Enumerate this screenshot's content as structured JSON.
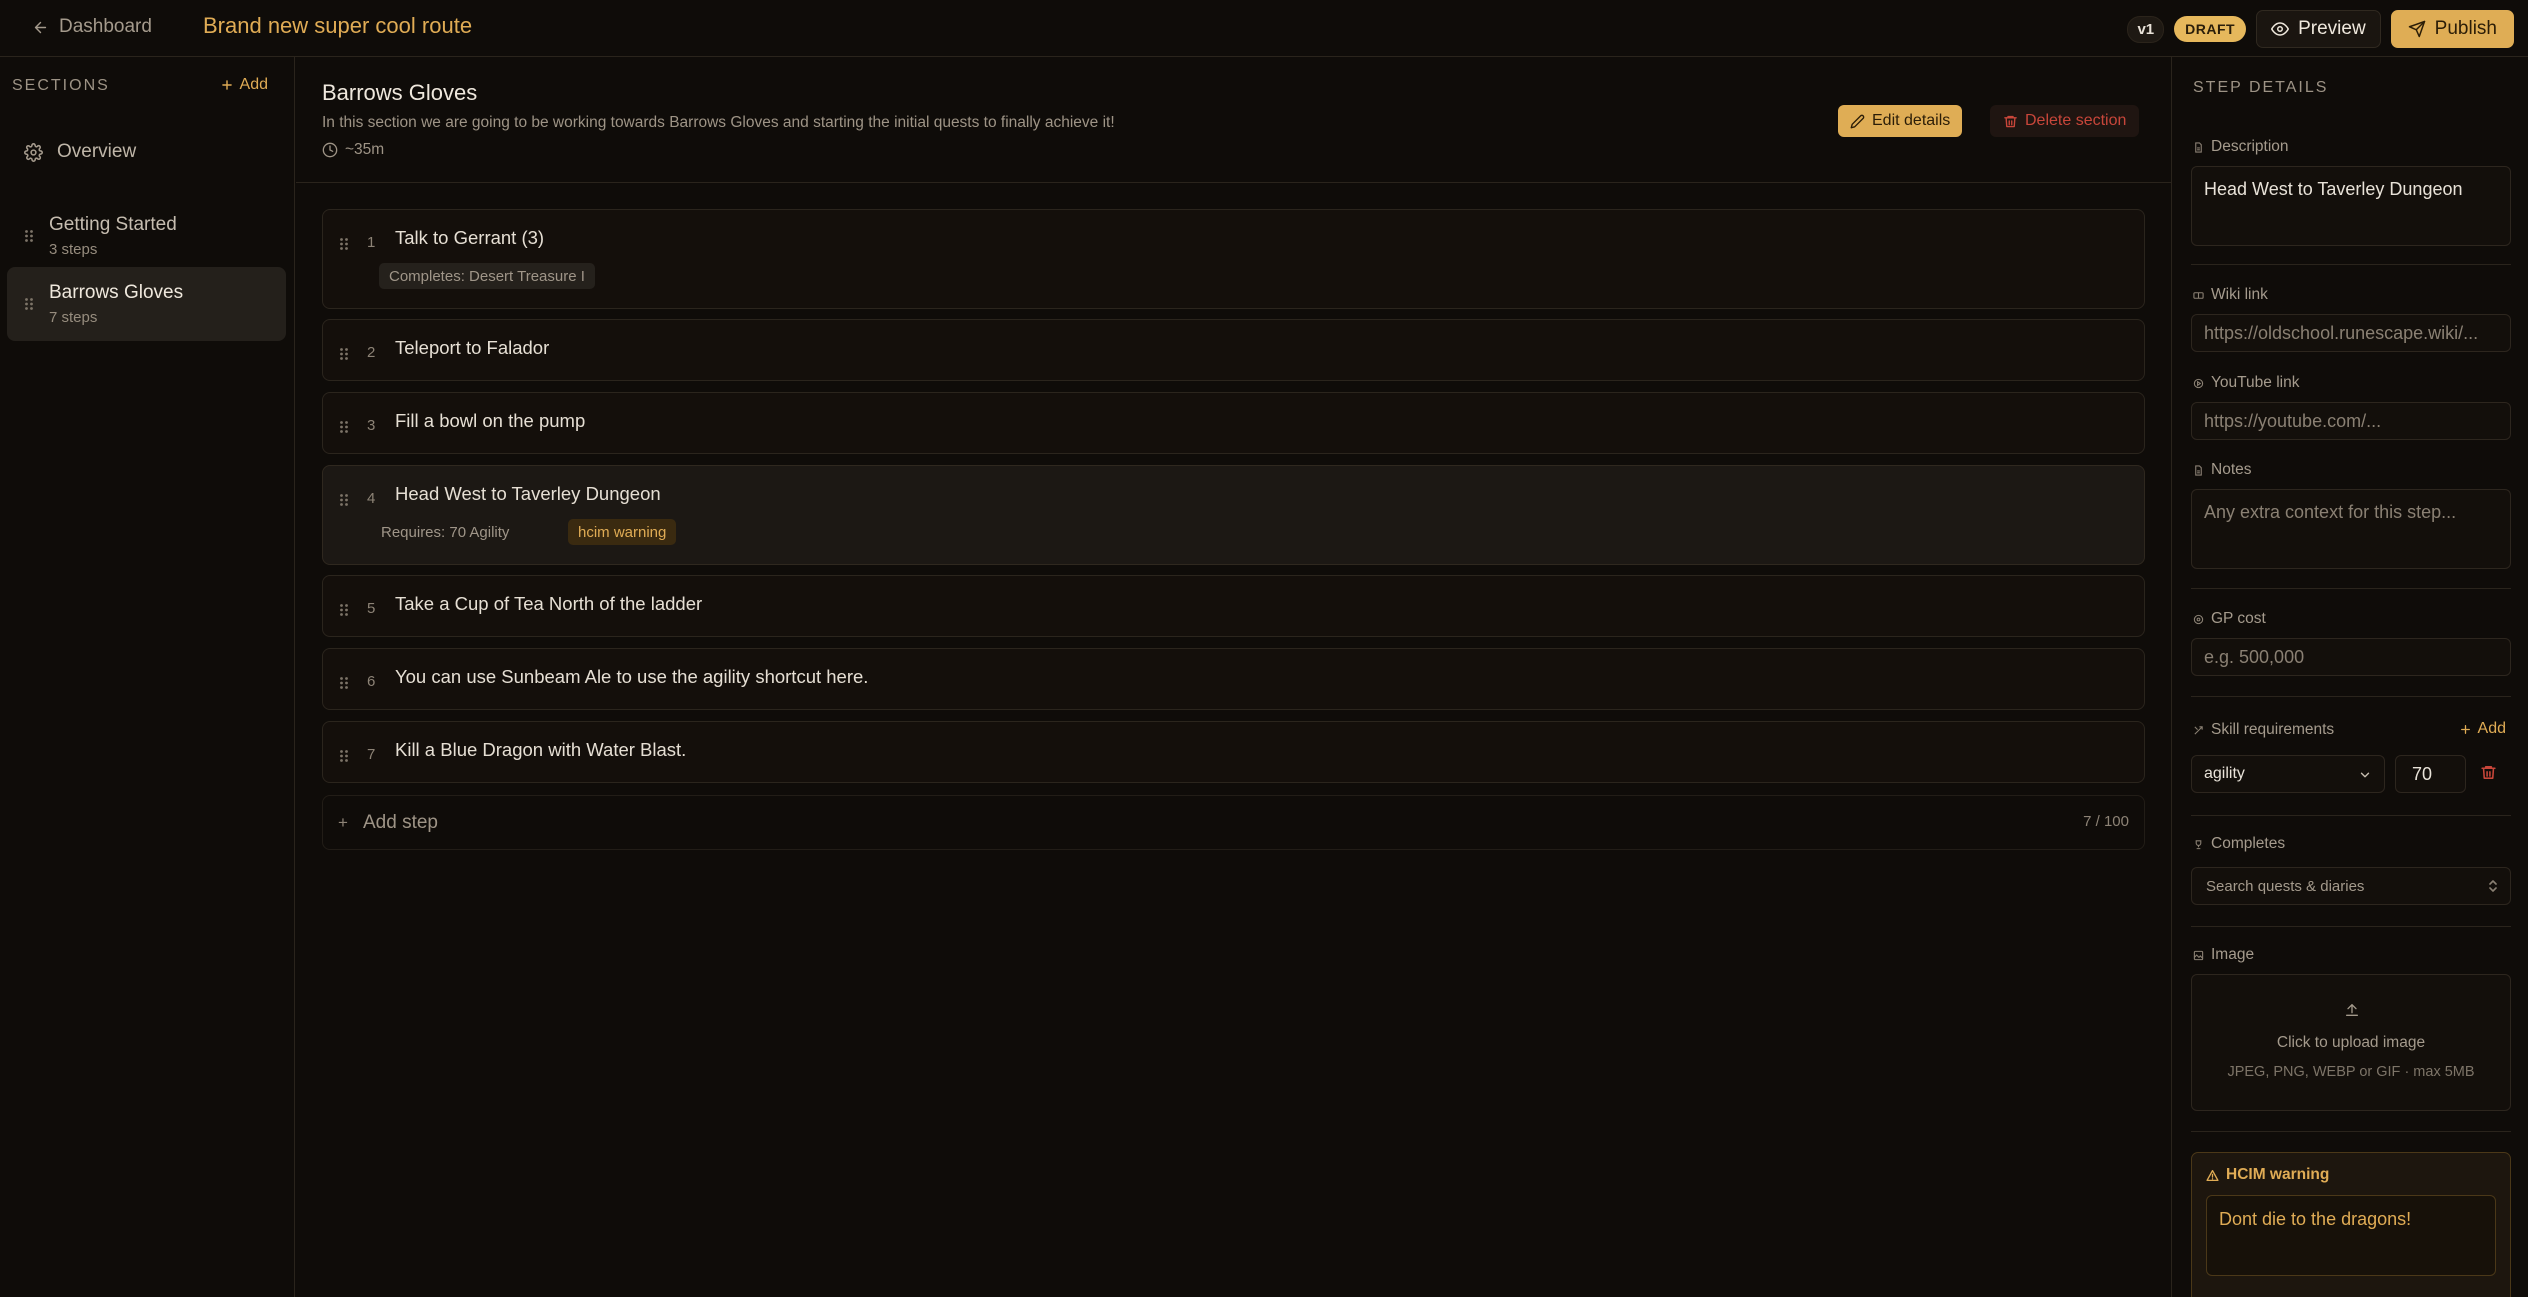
{
  "topbar": {
    "back_label": "Dashboard",
    "route_title": "Brand new super cool route",
    "version": "v1",
    "status": "DRAFT",
    "preview_label": "Preview",
    "publish_label": "Publish"
  },
  "sidebar": {
    "header": "SECTIONS",
    "add_label": "Add",
    "overview_label": "Overview",
    "sections": [
      {
        "name": "Getting Started",
        "count": "3 steps"
      },
      {
        "name": "Barrows Gloves",
        "count": "7 steps"
      }
    ]
  },
  "section": {
    "title": "Barrows Gloves",
    "description": "In this section we are going to be working towards Barrows Gloves and starting the initial quests to finally achieve it!",
    "time": "~35m",
    "edit_label": "Edit details",
    "delete_label": "Delete section"
  },
  "steps": [
    {
      "num": "1",
      "text": "Talk to Gerrant (3)",
      "completes": "Completes: Desert Treasure I"
    },
    {
      "num": "2",
      "text": "Teleport to Falador"
    },
    {
      "num": "3",
      "text": "Fill a bowl on the pump"
    },
    {
      "num": "4",
      "text": "Head West to Taverley Dungeon",
      "requires": "Requires: 70 Agility",
      "warning": "hcim warning"
    },
    {
      "num": "5",
      "text": "Take a Cup of Tea North of the ladder"
    },
    {
      "num": "6",
      "text": "You can use Sunbeam Ale to use the agility shortcut here."
    },
    {
      "num": "7",
      "text": "Kill a Blue Dragon with Water Blast."
    }
  ],
  "add_step": {
    "label": "Add step",
    "count": "7 / 100"
  },
  "details": {
    "title": "STEP DETAILS",
    "description_label": "Description",
    "description_value": "Head West to Taverley Dungeon",
    "wiki_label": "Wiki link",
    "wiki_placeholder": "https://oldschool.runescape.wiki/...",
    "youtube_label": "YouTube link",
    "youtube_placeholder": "https://youtube.com/...",
    "notes_label": "Notes",
    "notes_placeholder": "Any extra context for this step...",
    "gp_label": "GP cost",
    "gp_placeholder": "e.g. 500,000",
    "skill_label": "Skill requirements",
    "skill_add_label": "Add",
    "skill_name": "agility",
    "skill_level": "70",
    "completes_label": "Completes",
    "completes_placeholder": "Search quests & diaries",
    "image_label": "Image",
    "upload_label": "Click to upload image",
    "upload_hint": "JPEG, PNG, WEBP or GIF · max 5MB",
    "hcim_label": "HCIM warning",
    "hcim_text": "Dont die to the dragons!"
  },
  "colors": {
    "accent": "#dfad55",
    "background": "#0f0c09",
    "danger": "#c8463a"
  }
}
